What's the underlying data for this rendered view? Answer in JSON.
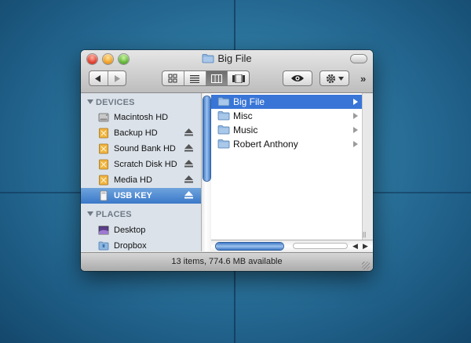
{
  "window": {
    "title": "Big File",
    "status": "13 items, 774.6 MB available"
  },
  "toolbar": {
    "back_icon": "left-arrow-icon",
    "forward_icon": "right-arrow-icon",
    "views": [
      "icon-view",
      "list-view",
      "column-view",
      "cover-flow-view"
    ],
    "active_view": "column-view",
    "more_label": "»"
  },
  "sidebar": {
    "devices_header": "DEVICES",
    "devices": [
      {
        "label": "Macintosh HD",
        "icon": "internal-drive-icon",
        "eject": false
      },
      {
        "label": "Backup HD",
        "icon": "external-drive-icon",
        "eject": true
      },
      {
        "label": "Sound Bank HD",
        "icon": "external-drive-icon",
        "eject": true
      },
      {
        "label": "Scratch Disk HD",
        "icon": "external-drive-icon",
        "eject": true
      },
      {
        "label": "Media HD",
        "icon": "external-drive-icon",
        "eject": true
      },
      {
        "label": "USB KEY",
        "icon": "usb-drive-icon",
        "eject": true,
        "selected": true
      }
    ],
    "places_header": "PLACES",
    "places": [
      {
        "label": "Desktop",
        "icon": "desktop-icon"
      },
      {
        "label": "Dropbox",
        "icon": "dropbox-icon"
      }
    ]
  },
  "column": {
    "items": [
      {
        "label": "Big File",
        "selected": true
      },
      {
        "label": "Misc"
      },
      {
        "label": "Music"
      },
      {
        "label": "Robert Anthony"
      }
    ]
  },
  "colors": {
    "selection": "#3875d7",
    "sidebar_bg": "#dbe2ea",
    "folder": "#7aa7d6"
  }
}
